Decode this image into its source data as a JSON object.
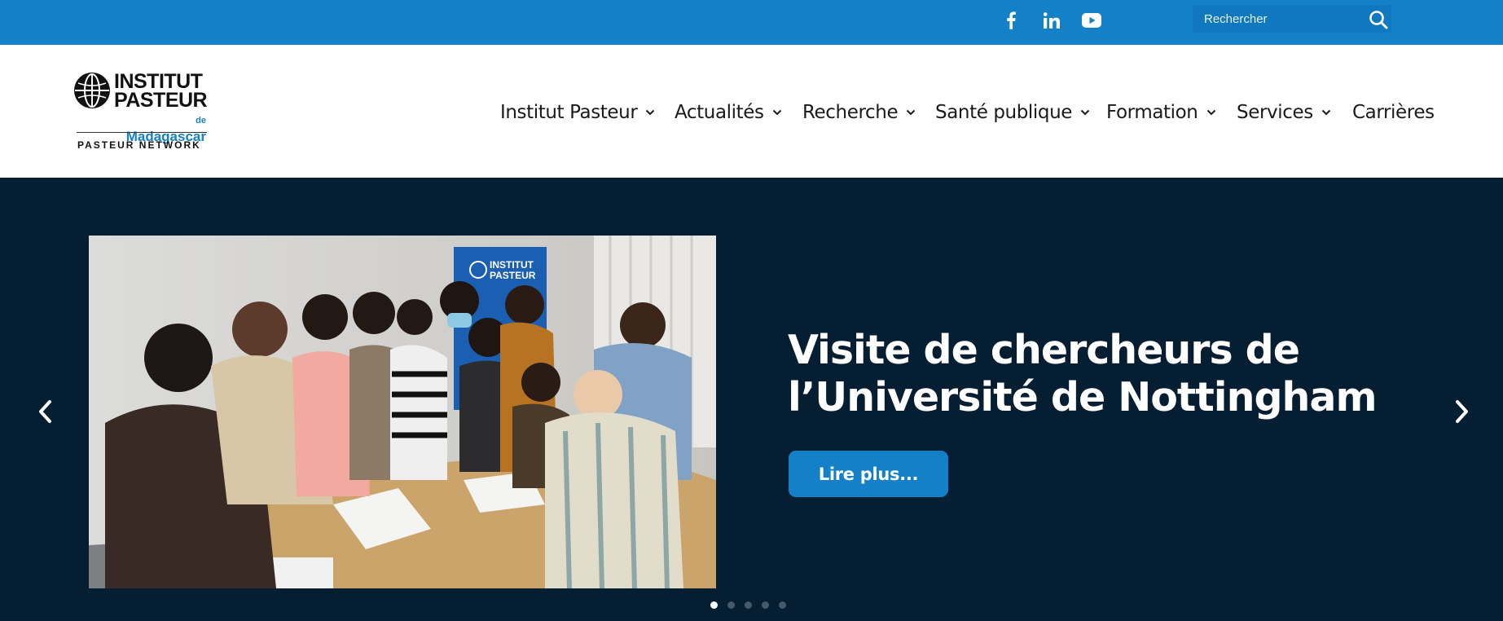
{
  "topbar": {
    "social": [
      {
        "icon": "facebook-icon"
      },
      {
        "icon": "linkedin-icon"
      },
      {
        "icon": "youtube-icon"
      }
    ],
    "search": {
      "placeholder": "Rechercher",
      "icon": "search-icon"
    }
  },
  "logo": {
    "line1": "INSTITUT",
    "line2": "PASTEUR",
    "line3_prefix": "de",
    "line3": "Madagascar",
    "network": "PASTEUR NETWORK"
  },
  "nav": {
    "items": [
      {
        "label": "Institut Pasteur",
        "dropdown": true
      },
      {
        "label": "Actualités",
        "dropdown": true
      },
      {
        "label": "Recherche",
        "dropdown": true
      },
      {
        "label": "Santé publique",
        "dropdown": true
      },
      {
        "label": "Formation",
        "dropdown": true
      },
      {
        "label": "Services",
        "dropdown": true
      },
      {
        "label": "Carrières",
        "dropdown": false
      }
    ]
  },
  "hero": {
    "title_line1": "Visite de chercheurs de",
    "title_line2": "l’Université de Nottingham",
    "button": "Lire plus...",
    "slides_count": 5,
    "active_slide": 1,
    "photo_banner": {
      "line1": "INSTITUT",
      "line2": "PASTEUR"
    }
  },
  "colors": {
    "topbar": "#1380c8",
    "hero_bg": "#061e31",
    "accent": "#1380c8"
  }
}
